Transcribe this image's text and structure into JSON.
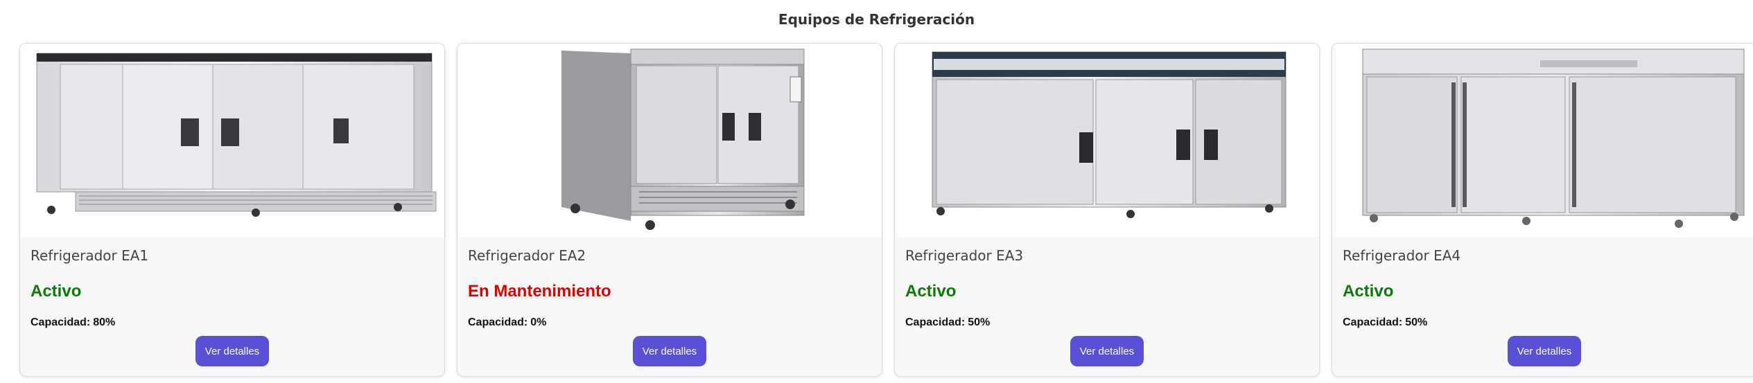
{
  "page": {
    "title": "Equipos de Refrigeración"
  },
  "cards": [
    {
      "name": "Refrigerador EA1",
      "status": "Activo",
      "status_color": "#0a7a0a",
      "capacity_label": "Capacidad:",
      "capacity_value": "80%",
      "button_label": "Ver detalles",
      "image_icon": "refrigerator-3-door-image"
    },
    {
      "name": "Refrigerador EA2",
      "status": "En Mantenimiento",
      "status_color": "#e00000",
      "capacity_label": "Capacidad:",
      "capacity_value": "0%",
      "button_label": "Ver detalles",
      "image_icon": "refrigerator-2-door-image"
    },
    {
      "name": "Refrigerador EA3",
      "status": "Activo",
      "status_color": "#0a7a0a",
      "capacity_label": "Capacidad:",
      "capacity_value": "50%",
      "button_label": "Ver detalles",
      "image_icon": "refrigerator-3-door-image"
    },
    {
      "name": "Refrigerador EA4",
      "status": "Activo",
      "status_color": "#0a7a0a",
      "capacity_label": "Capacidad:",
      "capacity_value": "50%",
      "button_label": "Ver detalles",
      "image_icon": "refrigerator-3-door-image"
    }
  ],
  "colors": {
    "accent": "#5a50d8",
    "active": "#0a7a0a",
    "maintenance": "#e00000"
  }
}
